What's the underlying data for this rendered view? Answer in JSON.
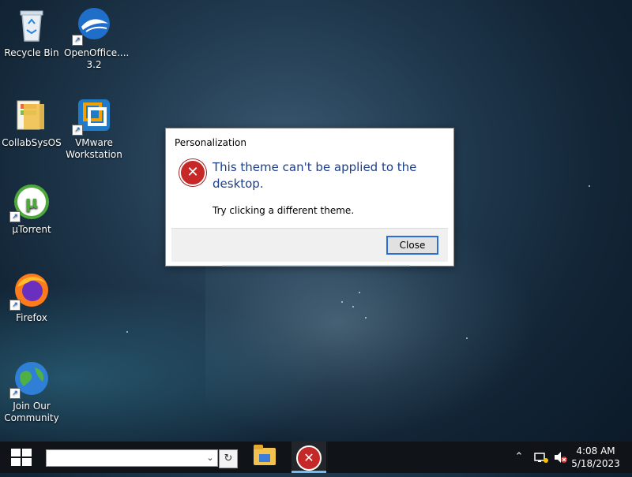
{
  "desktop": {
    "icons": [
      {
        "label": "Recycle Bin"
      },
      {
        "label": "OpenOffice.... 3.2"
      },
      {
        "label": "CollabSysOS"
      },
      {
        "label": "VMware Workstation"
      },
      {
        "label": "µTorrent"
      },
      {
        "label": "Firefox"
      },
      {
        "label": "Join Our Community"
      }
    ]
  },
  "dialog": {
    "title": "Personalization",
    "message": "This theme can't be applied to the desktop.",
    "detail": "Try clicking a different theme.",
    "close_label": "Close",
    "icon": "error-icon"
  },
  "taskbar": {
    "search_value": "",
    "apps": [
      {
        "name": "file-explorer",
        "icon": "folder-icon"
      },
      {
        "name": "error-dialog",
        "icon": "error-icon",
        "active": true
      }
    ],
    "clock": {
      "time": "4:08 AM",
      "date": "5/18/2023"
    }
  },
  "colors": {
    "dialog_message": "#1c3f8c",
    "error_red": "#c62828",
    "button_focus": "#2a6fd6"
  }
}
